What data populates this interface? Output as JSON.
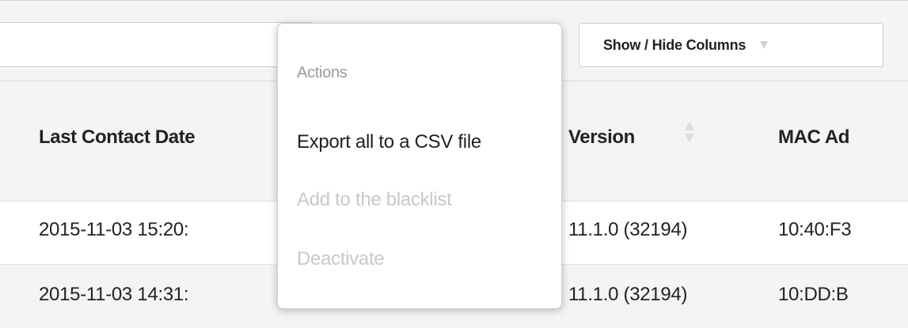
{
  "toolbar": {
    "search": {
      "value": "",
      "icon": "search-icon"
    },
    "columns_button": {
      "label": "Show / Hide Columns",
      "icon": "chevron-down-icon"
    }
  },
  "table": {
    "headers": {
      "last_contact_date": "Last Contact Date",
      "version": "Version",
      "mac_address": "MAC Ad"
    },
    "rows": [
      {
        "last_contact_date": "2015-11-03 15:20:",
        "version": "11.1.0 (32194)",
        "mac_address": "10:40:F3"
      },
      {
        "last_contact_date": "2015-11-03 14:31:",
        "version": "11.1.0 (32194)",
        "mac_address": "10:DD:B"
      }
    ]
  },
  "actions_menu": {
    "title": "Actions",
    "items": [
      {
        "label": "Export all to a CSV file",
        "enabled": true
      },
      {
        "label": "Add to the blacklist",
        "enabled": false
      },
      {
        "label": "Deactivate",
        "enabled": false
      }
    ]
  },
  "colors": {
    "background": "#f4f4f4",
    "text": "#222222",
    "muted": "#9a9a9a",
    "disabled": "#c9c9c9",
    "border": "#cfcfcf"
  }
}
